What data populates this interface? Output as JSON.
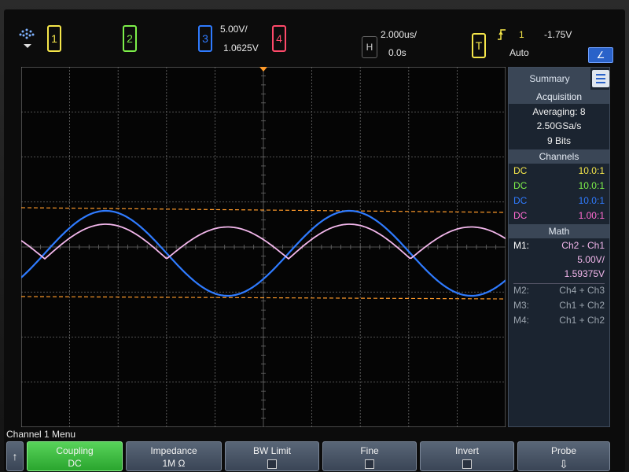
{
  "topbar": {
    "ch1_label": "1",
    "ch2_label": "2",
    "ch3_label": "3",
    "ch4_label": "4",
    "ch3_scale": "5.00V/",
    "ch3_offset": "1.0625V",
    "h_label": "H",
    "timebase": "2.000us/",
    "delay": "0.0s",
    "t_label": "T",
    "trigger_source": "1",
    "trigger_level": "-1.75V",
    "trigger_mode": "Auto",
    "trigger_mode_glyph": "∠"
  },
  "colors": {
    "ch1": "#f5e64a",
    "ch2": "#7df04a",
    "ch3": "#2f7bff",
    "ch4": "#ff4a6a",
    "math": "#f3b7ec",
    "cursor": "#ff9a2a",
    "grid": "#6b6b6b"
  },
  "panel": {
    "summary_label": "Summary",
    "acq_title": "Acquisition",
    "averaging": "Averaging: 8",
    "sample_rate": "2.50GSa/s",
    "bits": "9 Bits",
    "channels_title": "Channels",
    "channels": [
      {
        "coupling": "DC",
        "ratio": "10.0:1"
      },
      {
        "coupling": "DC",
        "ratio": "10.0:1"
      },
      {
        "coupling": "DC",
        "ratio": "10.0:1"
      },
      {
        "coupling": "DC",
        "ratio": "1.00:1"
      }
    ],
    "math_title": "Math",
    "m1_label": "M1:",
    "m1_func": "Ch2 - Ch1",
    "m1_scale": "5.00V/",
    "m1_offset": "1.59375V",
    "m2_label": "M2:",
    "m2_func": "Ch4 + Ch3",
    "m3_label": "M3:",
    "m3_func": "Ch1 + Ch2",
    "m4_label": "M4:",
    "m4_func": "Ch1 + Ch2"
  },
  "menu": {
    "title": "Channel 1 Menu",
    "up_glyph": "↑",
    "keys": {
      "coupling_label": "Coupling",
      "coupling_value": "DC",
      "impedance_label": "Impedance",
      "impedance_value": "1M Ω",
      "bwlimit_label": "BW Limit",
      "fine_label": "Fine",
      "invert_label": "Invert",
      "probe_label": "Probe",
      "probe_glyph": "⇩"
    }
  }
}
